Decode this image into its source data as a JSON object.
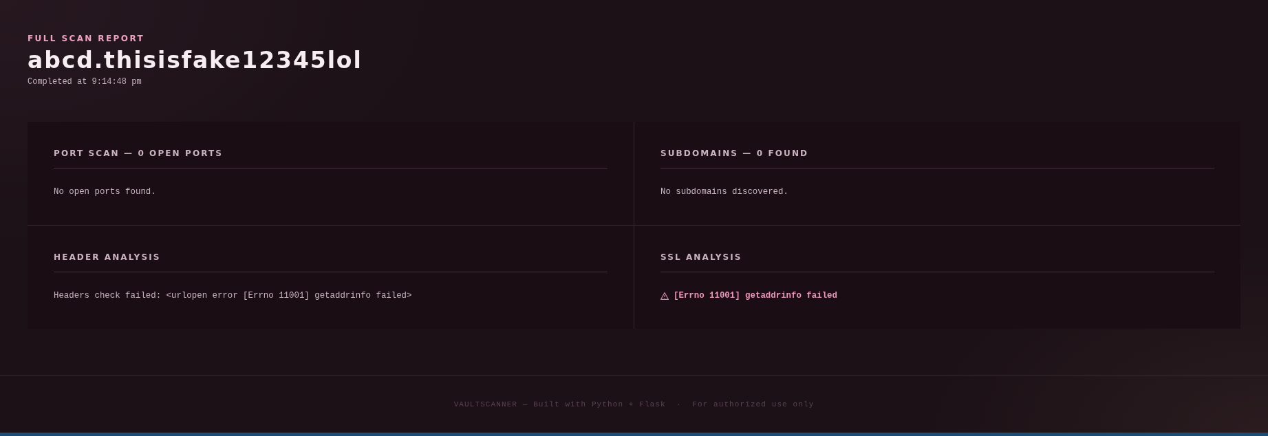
{
  "header": {
    "eyebrow": "FULL SCAN REPORT",
    "target": "abcd.thisisfake12345lol",
    "completed": "Completed at 9:14:48 pm"
  },
  "panels": [
    {
      "title": "PORT SCAN — 0 OPEN PORTS",
      "message": "No open ports found.",
      "kind": "note"
    },
    {
      "title": "SUBDOMAINS — 0 FOUND",
      "message": "No subdomains discovered.",
      "kind": "note"
    },
    {
      "title": "HEADER ANALYSIS",
      "message": "Headers check failed: <urlopen error [Errno 11001] getaddrinfo failed>",
      "kind": "note"
    },
    {
      "title": "SSL ANALYSIS",
      "message": "[Errno 11001] getaddrinfo failed",
      "kind": "error"
    }
  ],
  "footer": {
    "text": "VAULTSCANNER — Built with Python + Flask  ·  For authorized use only"
  }
}
